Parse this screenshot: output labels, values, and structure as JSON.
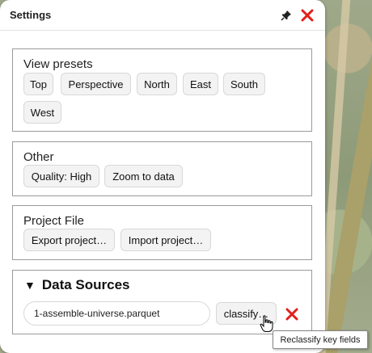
{
  "panel": {
    "title": "Settings",
    "pin_icon": "pin-icon",
    "close_icon": "close-icon",
    "close_color": "#e0201a"
  },
  "view_presets": {
    "title": "View presets",
    "buttons": [
      "Top",
      "Perspective",
      "North",
      "East",
      "South",
      "West"
    ]
  },
  "other": {
    "title": "Other",
    "quality_label": "Quality: High",
    "zoom_label": "Zoom to data"
  },
  "project_file": {
    "title": "Project File",
    "export_label": "Export project…",
    "import_label": "Import project…"
  },
  "data_sources": {
    "toggle": "▼",
    "title": "Data Sources",
    "file_name": "1-assemble-universe.parquet",
    "classify_label": "classify…",
    "remove_icon": "remove-icon"
  },
  "tooltip": "Reclassify key fields"
}
